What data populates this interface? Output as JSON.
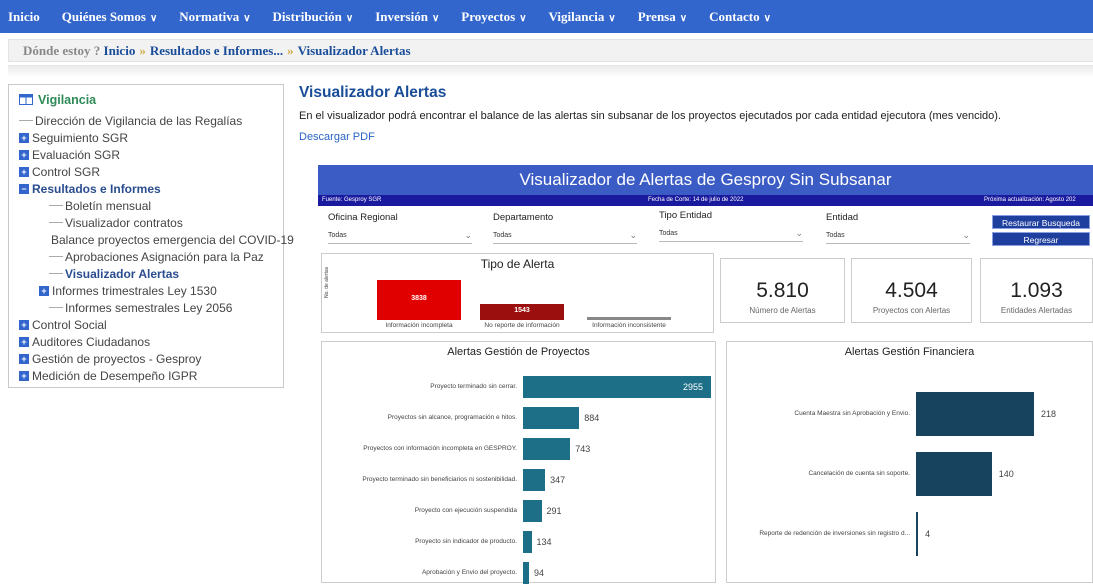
{
  "nav": {
    "items": [
      {
        "label": "Inicio",
        "dropdown": false
      },
      {
        "label": "Quiénes Somos",
        "dropdown": true
      },
      {
        "label": "Normativa",
        "dropdown": true
      },
      {
        "label": "Distribución",
        "dropdown": true
      },
      {
        "label": "Inversión",
        "dropdown": true
      },
      {
        "label": "Proyectos",
        "dropdown": true
      },
      {
        "label": "Vigilancia",
        "dropdown": true
      },
      {
        "label": "Prensa",
        "dropdown": true
      },
      {
        "label": "Contacto",
        "dropdown": true
      }
    ]
  },
  "breadcrumb": {
    "label": "Dónde estoy ?",
    "items": [
      "Inicio",
      "Resultados e Informes...",
      "Visualizador Alertas"
    ],
    "separator": "»"
  },
  "sidebar": {
    "root": "Vigilancia",
    "items": [
      {
        "label": "Dirección de Vigilancia de las Regalías",
        "type": "leaf"
      },
      {
        "label": "Seguimiento SGR",
        "type": "collapsed"
      },
      {
        "label": "Evaluación SGR",
        "type": "collapsed"
      },
      {
        "label": "Control SGR",
        "type": "collapsed"
      },
      {
        "label": "Resultados e Informes",
        "type": "expanded"
      },
      {
        "label": "Boletín mensual",
        "type": "sub"
      },
      {
        "label": "Visualizador contratos",
        "type": "sub"
      },
      {
        "label": "Balance proyectos emergencia del COVID-19",
        "type": "sub"
      },
      {
        "label": "Aprobaciones Asignación para la Paz",
        "type": "sub"
      },
      {
        "label": "Visualizador Alertas",
        "type": "sub-active"
      },
      {
        "label": "Informes trimestrales Ley 1530",
        "type": "sub-collapsed"
      },
      {
        "label": "Informes semestrales Ley 2056",
        "type": "sub"
      },
      {
        "label": "Control Social",
        "type": "collapsed"
      },
      {
        "label": "Auditores Ciudadanos",
        "type": "collapsed"
      },
      {
        "label": "Gestión de proyectos - Gesproy",
        "type": "collapsed"
      },
      {
        "label": "Medición de Desempeño IGPR",
        "type": "collapsed"
      }
    ]
  },
  "content": {
    "title": "Visualizador Alertas",
    "description": "En el visualizador podrá encontrar el balance de las alertas sin subsanar de los proyectos ejecutados por cada entidad ejecutora (mes vencido).",
    "pdf_link": "Descargar PDF"
  },
  "visualizer": {
    "title": "Visualizador de Alertas de Gesproy Sin Subsanar",
    "source": "Fuente: Gesproy SGR",
    "cut_date": "Fecha de Corte: 14 de julio de 2022",
    "next_update": "Próxima actualización: Agosto 202",
    "filters": [
      {
        "label": "Oficina Regional",
        "value": "Todas"
      },
      {
        "label": "Departamento",
        "value": "Todas"
      },
      {
        "label": "Tipo Entidad",
        "value": "Todas"
      },
      {
        "label": "Entidad",
        "value": "Todas"
      }
    ],
    "buttons": {
      "reset": "Restaurar Busqueda",
      "back": "Regresar"
    },
    "kpis": [
      {
        "value": "5.810",
        "label": "Número de Alertas"
      },
      {
        "value": "4.504",
        "label": "Proyectos con Alertas"
      },
      {
        "value": "1.093",
        "label": "Entidades Alertadas"
      }
    ],
    "colors": {
      "header": "#3b5cc4",
      "subbar": "#1a1a9e",
      "project_bar": "#1d6f87",
      "finance_bar": "#17435e"
    }
  },
  "chart_data": [
    {
      "type": "bar",
      "title": "Tipo de Alerta",
      "ylabel": "No. de alertas",
      "categories": [
        "Información incompleta",
        "No reporte de información",
        "Información inconsistente"
      ],
      "values": [
        3838,
        1543,
        0
      ],
      "value_labels": [
        "3838",
        "1543",
        ""
      ],
      "colors": [
        "#e00000",
        "#9b0f0f",
        "#888888"
      ]
    },
    {
      "type": "bar",
      "orientation": "horizontal",
      "title": "Alertas Gestión de Proyectos",
      "categories": [
        "Proyecto terminado sin cerrar.",
        "Proyectos sin alcance, programación e hitos.",
        "Proyectos con información incompleta en GESPROY.",
        "Proyecto terminado sin beneficiarios ni sostenibilidad.",
        "Proyecto con ejecución suspendida",
        "Proyecto sin indicador de producto.",
        "Aprobación y Envio del proyecto."
      ],
      "values": [
        2955,
        884,
        743,
        347,
        291,
        134,
        94
      ]
    },
    {
      "type": "bar",
      "orientation": "horizontal",
      "title": "Alertas Gestión Financiera",
      "categories": [
        "Cuenta Maestra sin Aprobación y Envio.",
        "Cancelación de cuenta sin soporte.",
        "Reporte de redención de inversiones sin registro d..."
      ],
      "values": [
        218,
        140,
        4
      ]
    }
  ]
}
